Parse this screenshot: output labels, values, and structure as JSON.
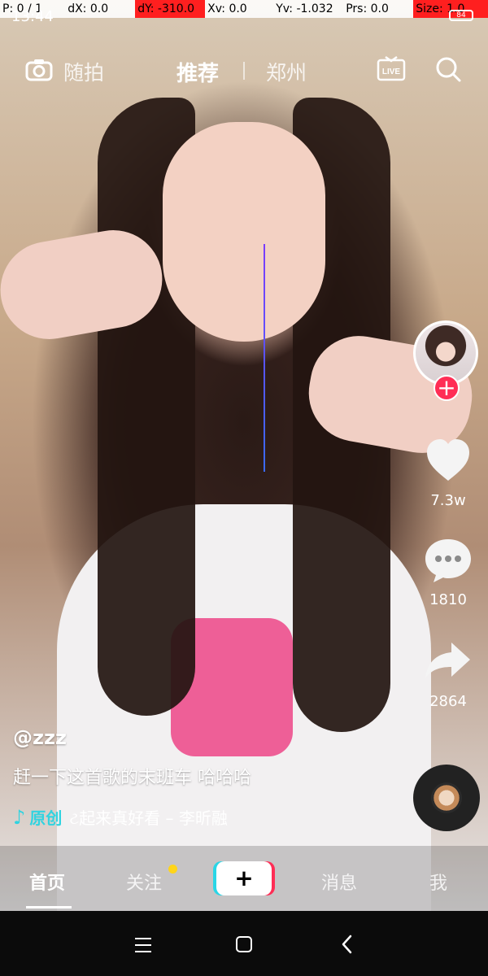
{
  "debug": {
    "p": "P: 0 / 1",
    "dx": "dX: 0.0",
    "dy": "dY: -310.0",
    "xv": "Xv: 0.0",
    "yv": "Yv: -1.032",
    "prs": "Prs: 0.0",
    "size": "Size: 1.0"
  },
  "status": {
    "time": "13:44",
    "battery": "84"
  },
  "topnav": {
    "snap": "随拍",
    "recommend": "推荐",
    "city": "郑州",
    "live_label": "LIVE"
  },
  "post": {
    "username": "@zzz",
    "description": "赶一下这首歌的末班车 哈哈哈",
    "music_tag": "原创",
    "music_title": "ટ起来真好看 – 李昕融"
  },
  "actions": {
    "likes": "7.3w",
    "comments": "1810",
    "shares": "2864"
  },
  "tabs": {
    "home": "首页",
    "follow": "关注",
    "create": "+",
    "messages": "消息",
    "me": "我"
  },
  "colors": {
    "accent_pink": "#ff2d55",
    "accent_cyan": "#31d3e0",
    "notification_dot": "#ffd51a"
  }
}
